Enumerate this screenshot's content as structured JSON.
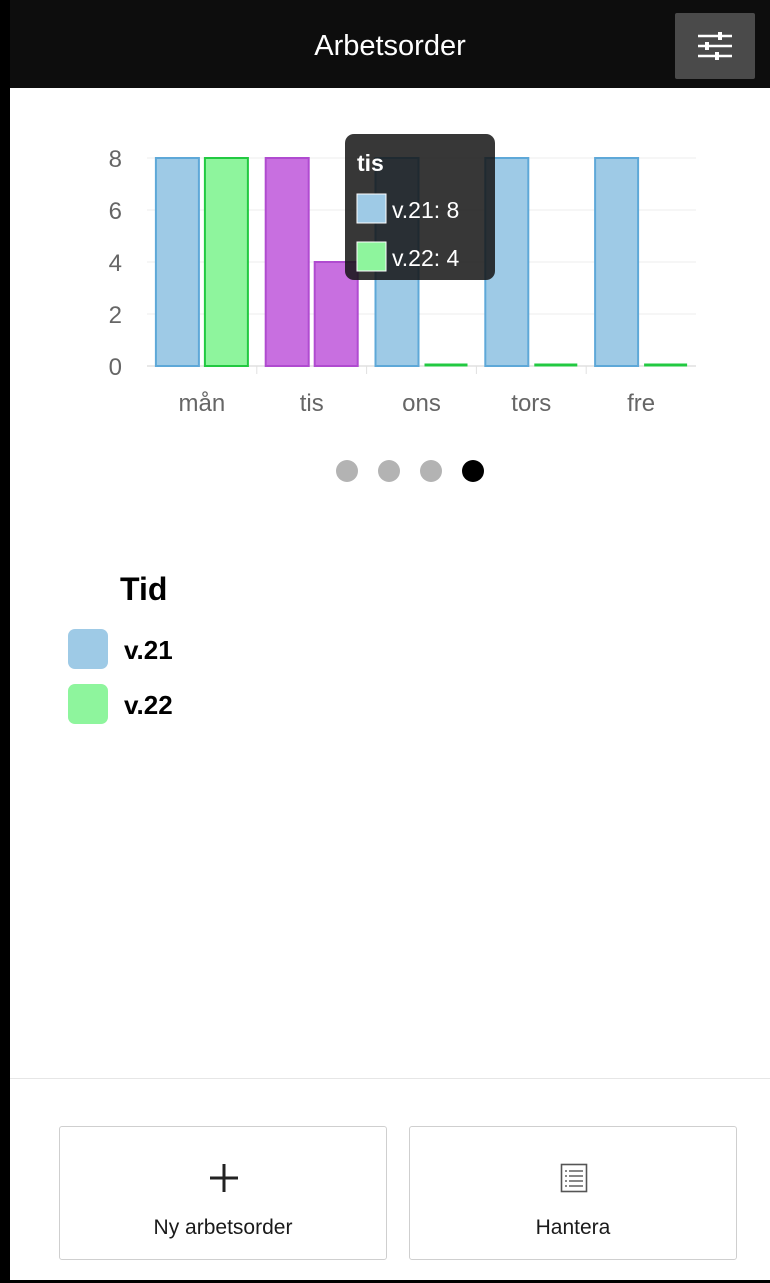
{
  "header": {
    "title": "Arbetsorder",
    "filter_icon": "sliders-icon"
  },
  "chart_data": {
    "type": "bar",
    "categories": [
      "mån",
      "tis",
      "ons",
      "tors",
      "fre"
    ],
    "series": [
      {
        "name": "v.21",
        "values": [
          8,
          8,
          8,
          8,
          8
        ],
        "color": "#9ecae6",
        "border": "#5ea8d8"
      },
      {
        "name": "v.22",
        "values": [
          8,
          4,
          0,
          0,
          0
        ],
        "color": "#8ef59d",
        "border": "#22c941"
      }
    ],
    "highlight_category": "tis",
    "highlight_color": "#c86fe0",
    "highlight_border": "#b04bd0",
    "ylim": [
      0,
      8
    ],
    "yticks": [
      0,
      2,
      4,
      6,
      8
    ],
    "grid": true,
    "tooltip": {
      "title": "tis",
      "rows": [
        {
          "label": "v.21: 8",
          "color": "#9ecae6"
        },
        {
          "label": "v.22: 4",
          "color": "#8ef59d"
        }
      ]
    }
  },
  "pagination": {
    "count": 4,
    "active": 4
  },
  "legend": {
    "title": "Tid",
    "items": [
      {
        "label": "v.21",
        "color": "#9ecae6"
      },
      {
        "label": "v.22",
        "color": "#8ef59d"
      }
    ]
  },
  "actions": [
    {
      "label": "Ny arbetsorder",
      "icon": "plus-icon"
    },
    {
      "label": "Hantera",
      "icon": "list-icon"
    }
  ]
}
